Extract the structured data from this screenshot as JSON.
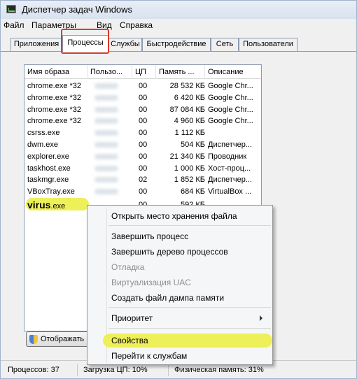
{
  "window": {
    "title": "Диспетчер задач Windows"
  },
  "menu": [
    "Файл",
    "Параметры",
    "Вид",
    "Справка"
  ],
  "tabs": [
    "Приложения",
    "Процессы",
    "Службы",
    "Быстродействие",
    "Сеть",
    "Пользователи"
  ],
  "active_tab": "Процессы",
  "columns": [
    "Имя образа",
    "Пользо...",
    "ЦП",
    "Память ...",
    "Описание"
  ],
  "processes": [
    {
      "name": "chrome.exe *32",
      "cpu": "00",
      "mem": "28 532 КБ",
      "desc": "Google Chr..."
    },
    {
      "name": "chrome.exe *32",
      "cpu": "00",
      "mem": "6 420 КБ",
      "desc": "Google Chr..."
    },
    {
      "name": "chrome.exe *32",
      "cpu": "00",
      "mem": "87 084 КБ",
      "desc": "Google Chr..."
    },
    {
      "name": "chrome.exe *32",
      "cpu": "00",
      "mem": "4 960 КБ",
      "desc": "Google Chr..."
    },
    {
      "name": "csrss.exe",
      "cpu": "00",
      "mem": "1 112 КБ",
      "desc": ""
    },
    {
      "name": "dwm.exe",
      "cpu": "00",
      "mem": "504 КБ",
      "desc": "Диспетчер..."
    },
    {
      "name": "explorer.exe",
      "cpu": "00",
      "mem": "21 340 КБ",
      "desc": "Проводник"
    },
    {
      "name": "taskhost.exe",
      "cpu": "00",
      "mem": "1 000 КБ",
      "desc": "Хост-проц..."
    },
    {
      "name": "taskmgr.exe",
      "cpu": "02",
      "mem": "1 852 КБ",
      "desc": "Диспетчер..."
    },
    {
      "name": "VBoxTray.exe",
      "cpu": "00",
      "mem": "684 КБ",
      "desc": "VirtualBox ..."
    }
  ],
  "virus_row": {
    "name_main": "virus",
    "name_ext": ".exe",
    "cpu": "00",
    "mem": "592 КБ"
  },
  "show_button": "Отображать",
  "context_menu": {
    "open_location": "Открыть место хранения файла",
    "end_process": "Завершить процесс",
    "end_tree": "Завершить дерево процессов",
    "debug": "Отладка",
    "uac": "Виртуализация UAC",
    "dump": "Создать файл дампа памяти",
    "priority": "Приоритет",
    "properties": "Свойства",
    "services": "Перейти к службам"
  },
  "status": {
    "processes": "Процессов: 37",
    "cpu": "Загрузка ЦП: 10%",
    "memory": "Физическая память: 31%"
  },
  "colors": {
    "highlight": "#eef05a",
    "tab_outline": "#e0392b"
  }
}
